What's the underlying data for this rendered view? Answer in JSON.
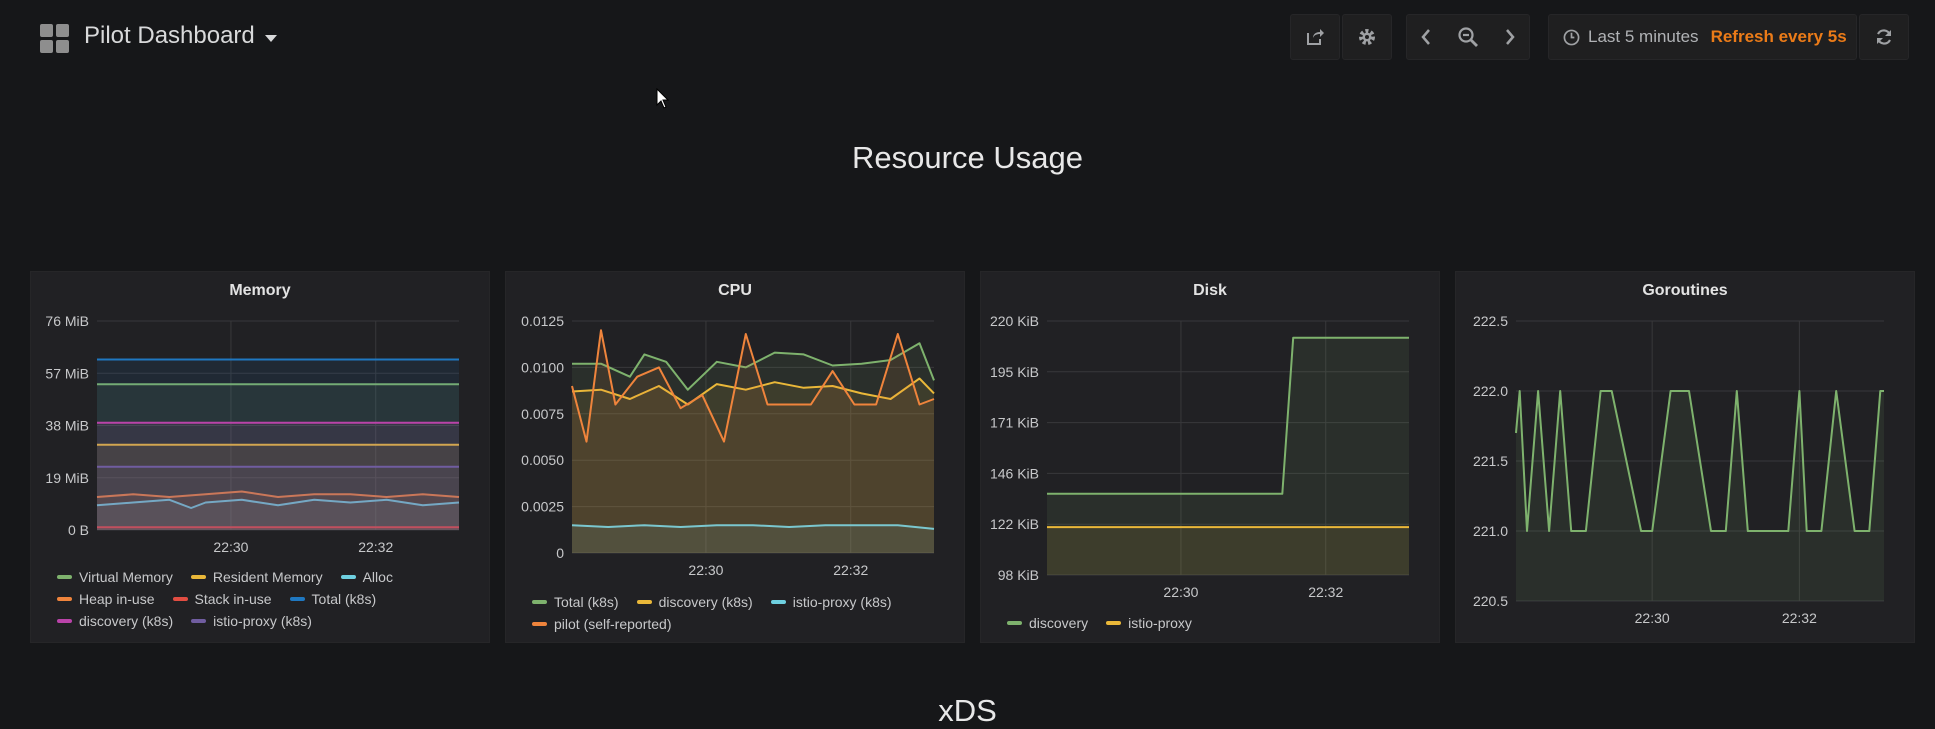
{
  "header": {
    "title": "Pilot Dashboard",
    "time_range": "Last 5 minutes",
    "refresh": "Refresh every 5s"
  },
  "icons": {
    "share": "share-icon",
    "settings": "gear-icon",
    "prev": "chevron-left-icon",
    "zoom": "zoom-out-icon",
    "next": "chevron-right-icon",
    "clock": "clock-icon",
    "refresh": "refresh-icon"
  },
  "colors": {
    "background": "#161719",
    "panel": "#212124",
    "accent_orange": "#eb7b18",
    "green": "#7eb26d",
    "yellow": "#eab839",
    "cyan": "#6ed0e0",
    "orange": "#ef843c",
    "red": "#e24d42",
    "blue": "#1f78c1",
    "purple": "#ba43a9",
    "violet": "#705da0"
  },
  "sections": [
    "Resource Usage",
    "xDS"
  ],
  "chart_data": [
    {
      "id": "memory",
      "type": "line",
      "title": "Memory",
      "x_ticks": [
        "22:30",
        "22:32"
      ],
      "y_ticks": [
        "76 MiB",
        "57 MiB",
        "38 MiB",
        "19 MiB",
        "0 B"
      ],
      "ylim": [
        0,
        76
      ],
      "y_unit": "MiB",
      "x_range_min": [
        0,
        5
      ],
      "x_tick_positions_min": [
        1.85,
        3.85
      ],
      "grid": true,
      "legend_position": "bottom",
      "series": [
        {
          "name": "Virtual Memory",
          "color": "#7eb26d",
          "constant": 53
        },
        {
          "name": "Resident Memory",
          "color": "#eab839",
          "constant": 31
        },
        {
          "name": "Alloc",
          "color": "#6ed0e0",
          "x": [
            0,
            0.5,
            1,
            1.3,
            1.5,
            2,
            2.5,
            3,
            3.5,
            4,
            4.5,
            5
          ],
          "values": [
            9,
            10,
            11,
            8,
            10,
            11,
            9,
            11,
            10,
            11,
            9,
            10
          ]
        },
        {
          "name": "Heap in-use",
          "color": "#ef843c",
          "x": [
            0,
            0.5,
            1,
            1.5,
            2,
            2.5,
            3,
            3.5,
            4,
            4.5,
            5
          ],
          "values": [
            12,
            13,
            12,
            13,
            14,
            12,
            13,
            13,
            12,
            13,
            12
          ]
        },
        {
          "name": "Stack in-use",
          "color": "#e24d42",
          "constant": 1
        },
        {
          "name": "Total (k8s)",
          "color": "#1f78c1",
          "constant": 62
        },
        {
          "name": "discovery (k8s)",
          "color": "#ba43a9",
          "constant": 39
        },
        {
          "name": "istio-proxy (k8s)",
          "color": "#705da0",
          "constant": 23
        }
      ]
    },
    {
      "id": "cpu",
      "type": "line",
      "title": "CPU",
      "x_ticks": [
        "22:30",
        "22:32"
      ],
      "y_ticks": [
        "0.0125",
        "0.0100",
        "0.0075",
        "0.0050",
        "0.0025",
        "0"
      ],
      "ylim": [
        0,
        0.0125
      ],
      "x_range_min": [
        0,
        5
      ],
      "x_tick_positions_min": [
        1.85,
        3.85
      ],
      "grid": true,
      "legend_position": "bottom",
      "series": [
        {
          "name": "Total (k8s)",
          "color": "#7eb26d",
          "x": [
            0,
            0.4,
            0.8,
            1.0,
            1.3,
            1.6,
            2.0,
            2.4,
            2.8,
            3.2,
            3.6,
            4.0,
            4.4,
            4.8,
            5
          ],
          "values": [
            0.0102,
            0.0102,
            0.0095,
            0.0107,
            0.0103,
            0.0088,
            0.0103,
            0.01,
            0.0108,
            0.0107,
            0.0101,
            0.0102,
            0.0104,
            0.0113,
            0.0093
          ]
        },
        {
          "name": "discovery (k8s)",
          "color": "#eab839",
          "x": [
            0,
            0.4,
            0.8,
            1.2,
            1.6,
            2.0,
            2.4,
            2.8,
            3.2,
            3.6,
            4.0,
            4.4,
            4.8,
            5
          ],
          "values": [
            0.0087,
            0.0088,
            0.0083,
            0.009,
            0.008,
            0.0091,
            0.0088,
            0.0092,
            0.0089,
            0.009,
            0.0086,
            0.0083,
            0.0094,
            0.0086
          ]
        },
        {
          "name": "istio-proxy (k8s)",
          "color": "#6ed0e0",
          "x": [
            0,
            0.5,
            1,
            1.5,
            2,
            2.5,
            3,
            3.5,
            4,
            4.5,
            5
          ],
          "values": [
            0.0015,
            0.0014,
            0.0015,
            0.0014,
            0.0015,
            0.0015,
            0.0014,
            0.0015,
            0.0015,
            0.0015,
            0.0013
          ]
        },
        {
          "name": "pilot (self-reported)",
          "color": "#ef843c",
          "x": [
            0,
            0.2,
            0.4,
            0.6,
            0.9,
            1.2,
            1.5,
            1.8,
            2.1,
            2.4,
            2.7,
            3.0,
            3.3,
            3.6,
            3.9,
            4.2,
            4.5,
            4.8,
            5
          ],
          "values": [
            0.009,
            0.006,
            0.012,
            0.008,
            0.0095,
            0.01,
            0.0078,
            0.0085,
            0.006,
            0.0118,
            0.008,
            0.008,
            0.008,
            0.0098,
            0.008,
            0.008,
            0.0118,
            0.008,
            0.0083
          ]
        }
      ]
    },
    {
      "id": "disk",
      "type": "line",
      "title": "Disk",
      "x_ticks": [
        "22:30",
        "22:32"
      ],
      "y_ticks": [
        "220 KiB",
        "195 KiB",
        "171 KiB",
        "146 KiB",
        "122 KiB",
        "98 KiB"
      ],
      "ylim": [
        98,
        220
      ],
      "y_unit": "KiB",
      "x_range_min": [
        0,
        5
      ],
      "x_tick_positions_min": [
        1.85,
        3.85
      ],
      "grid": true,
      "legend_position": "bottom",
      "series": [
        {
          "name": "discovery",
          "color": "#7eb26d",
          "x": [
            0,
            3.25,
            3.4,
            5
          ],
          "values": [
            137,
            137,
            212,
            212
          ]
        },
        {
          "name": "istio-proxy",
          "color": "#eab839",
          "x": [
            0,
            5
          ],
          "values": [
            121,
            121
          ]
        }
      ]
    },
    {
      "id": "goroutines",
      "type": "line",
      "title": "Goroutines",
      "x_ticks": [
        "22:30",
        "22:32"
      ],
      "y_ticks": [
        "222.5",
        "222.0",
        "221.5",
        "221.0",
        "220.5"
      ],
      "ylim": [
        220.5,
        222.5
      ],
      "x_range_min": [
        0,
        5
      ],
      "x_tick_positions_min": [
        1.85,
        3.85
      ],
      "grid": true,
      "legend_position": "none",
      "series": [
        {
          "name": "",
          "color": "#7eb26d",
          "x": [
            0,
            0.05,
            0.15,
            0.3,
            0.45,
            0.6,
            0.75,
            0.95,
            1.15,
            1.3,
            1.7,
            1.85,
            2.1,
            2.35,
            2.65,
            2.85,
            3.0,
            3.15,
            3.5,
            3.7,
            3.85,
            3.95,
            4.15,
            4.35,
            4.6,
            4.8,
            4.95,
            5
          ],
          "values": [
            221.7,
            222.0,
            221.0,
            222.0,
            221.0,
            222.0,
            221.0,
            221.0,
            222.0,
            222.0,
            221.0,
            221.0,
            222.0,
            222.0,
            221.0,
            221.0,
            222.0,
            221.0,
            221.0,
            221.0,
            222.0,
            221.0,
            221.0,
            222.0,
            221.0,
            221.0,
            222.0,
            222.0
          ]
        }
      ]
    }
  ]
}
